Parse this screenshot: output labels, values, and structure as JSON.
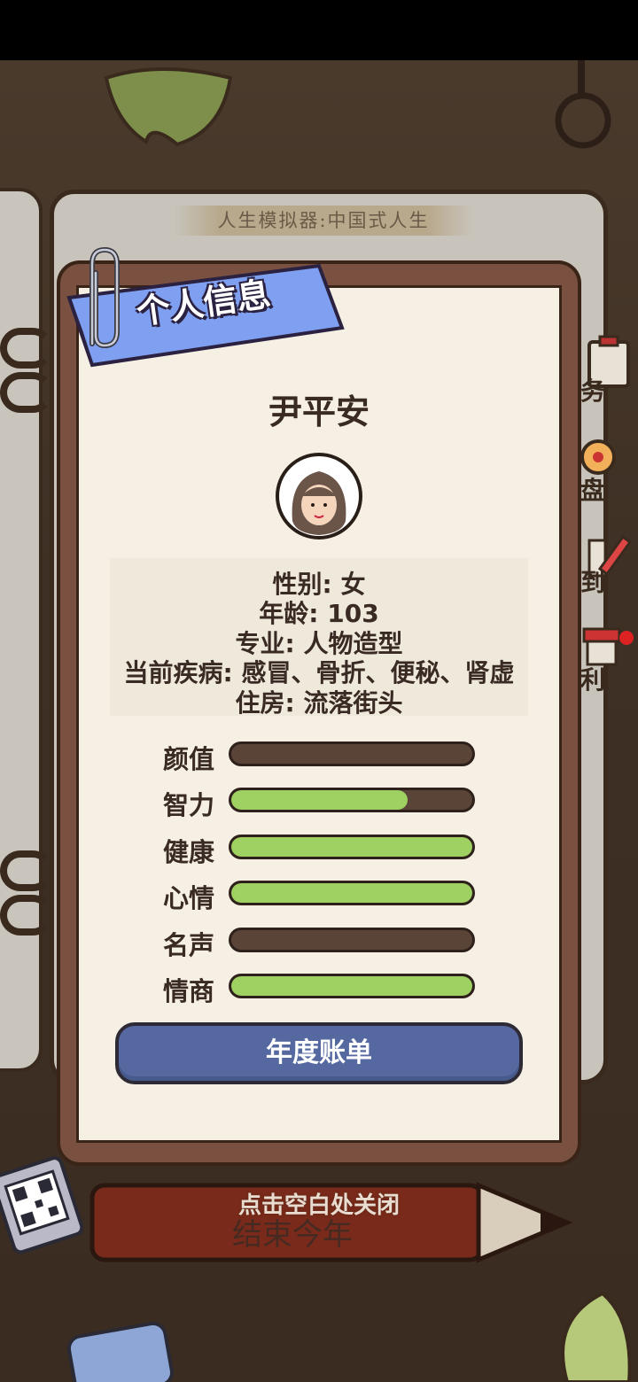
{
  "book": {
    "title": "人生模拟器:中国式人生",
    "side_tabs": [
      {
        "label": "务",
        "icon": "clipboard-icon"
      },
      {
        "label": "盘",
        "icon": "compass-icon"
      },
      {
        "label": "到",
        "icon": "pencil-icon"
      },
      {
        "label": "利",
        "icon": "shop-icon"
      }
    ],
    "end_year_label": "结束今年"
  },
  "card": {
    "ribbon_title": "个人信息",
    "name": "尹平安",
    "info": {
      "gender": "性别: 女",
      "age": "年龄: 103",
      "major": "专业: 人物造型",
      "illness": "当前疾病: 感冒、骨折、便秘、肾虚",
      "housing": "住房: 流落街头"
    },
    "stats": [
      {
        "label": "颜值",
        "level": 0
      },
      {
        "label": "智力",
        "level": 0.73
      },
      {
        "label": "健康",
        "level": 1
      },
      {
        "label": "心情",
        "level": 1
      },
      {
        "label": "名声",
        "level": 0
      },
      {
        "label": "情商",
        "level": 1
      }
    ],
    "bill_button": "年度账单"
  },
  "close_hint": "点击空白处关闭",
  "colors": {
    "bar_fill": "#9ed162",
    "bar_empty": "#5a4438",
    "button": "#5569a0",
    "ribbon": "#7f9ff0"
  }
}
